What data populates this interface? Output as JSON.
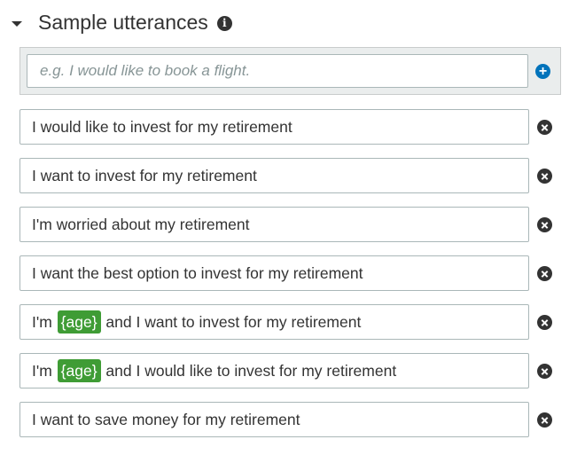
{
  "section": {
    "title": "Sample utterances",
    "info_icon": "info-icon"
  },
  "new_utterance": {
    "placeholder": "e.g. I would like to book a flight.",
    "value": "",
    "add_icon": "plus-circle-icon"
  },
  "utterances": [
    {
      "segments": [
        {
          "text": "I would like to invest for my retirement"
        }
      ]
    },
    {
      "segments": [
        {
          "text": "I want to invest for my retirement"
        }
      ]
    },
    {
      "segments": [
        {
          "text": "I'm worried about my retirement"
        }
      ]
    },
    {
      "segments": [
        {
          "text": "I want the best option to invest for my retirement"
        }
      ]
    },
    {
      "segments": [
        {
          "text": "I'm "
        },
        {
          "text": "{age}",
          "slot": true
        },
        {
          "text": " and I want to invest for my retirement"
        }
      ]
    },
    {
      "segments": [
        {
          "text": "I'm "
        },
        {
          "text": "{age}",
          "slot": true
        },
        {
          "text": " and I would like to invest for my retirement"
        }
      ]
    },
    {
      "segments": [
        {
          "text": "I want to save money for my retirement"
        }
      ]
    }
  ],
  "remove_icon": "close-circle-icon",
  "colors": {
    "slot_badge": "#3f9c35",
    "add_button": "#0073bb",
    "text": "#333333"
  }
}
